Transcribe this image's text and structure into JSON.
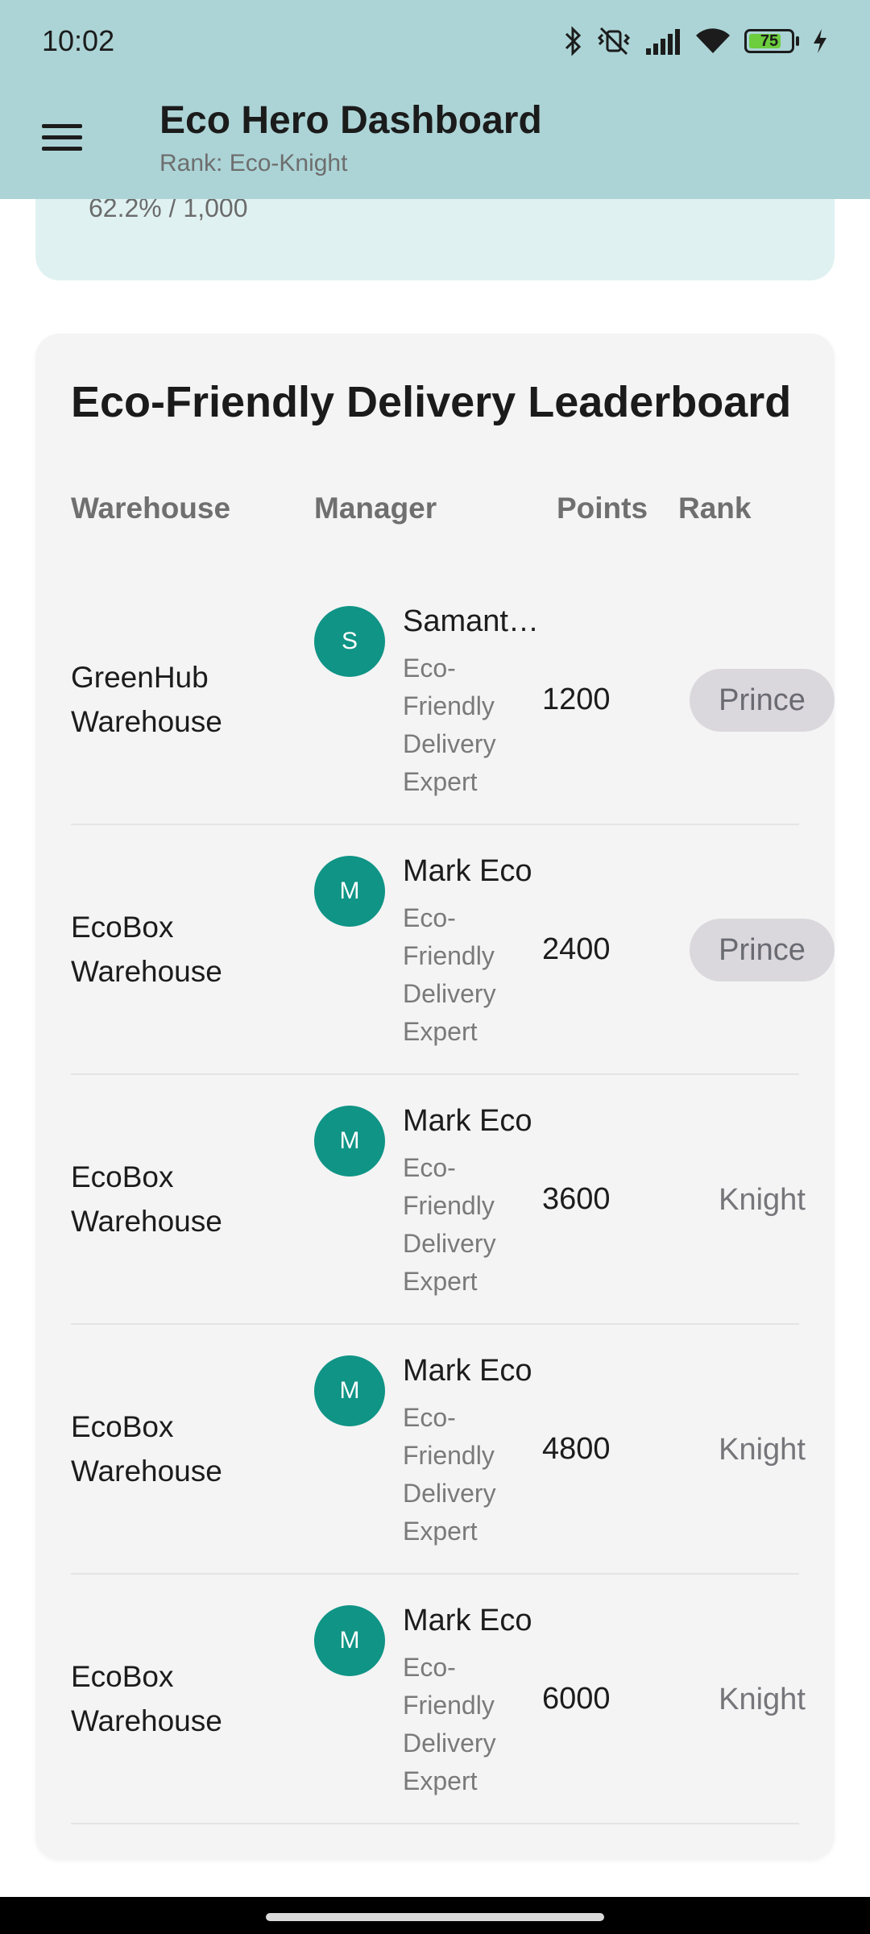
{
  "status_bar": {
    "time": "10:02",
    "battery_level": "75",
    "icons": [
      "bluetooth-icon",
      "vibrate-off-icon",
      "signal-icon",
      "wifi-icon",
      "battery-icon",
      "charging-icon"
    ]
  },
  "app_bar": {
    "title": "Eco Hero Dashboard",
    "subtitle": "Rank: Eco-Knight",
    "menu_icon": "hamburger-menu-icon"
  },
  "progress": {
    "text": "62.2% / 1,000"
  },
  "leaderboard": {
    "title": "Eco-Friendly Delivery Leaderboard",
    "columns": {
      "warehouse": "Warehouse",
      "manager": "Manager",
      "points": "Points",
      "rank": "Rank"
    },
    "rows": [
      {
        "warehouse": "GreenHub Warehouse",
        "initial": "S",
        "manager": "Samantha",
        "role": "Eco-Friendly Delivery Expert",
        "points": "1200",
        "rank": "Prince",
        "rank_style": "chip"
      },
      {
        "warehouse": "EcoBox Warehouse",
        "initial": "M",
        "manager": "Mark Eco",
        "role": "Eco-Friendly Delivery Expert",
        "points": "2400",
        "rank": "Prince",
        "rank_style": "chip"
      },
      {
        "warehouse": "EcoBox Warehouse",
        "initial": "M",
        "manager": "Mark Eco",
        "role": "Eco-Friendly Delivery Expert",
        "points": "3600",
        "rank": "Knight",
        "rank_style": "text"
      },
      {
        "warehouse": "EcoBox Warehouse",
        "initial": "M",
        "manager": "Mark Eco",
        "role": "Eco-Friendly Delivery Expert",
        "points": "4800",
        "rank": "Knight",
        "rank_style": "text"
      },
      {
        "warehouse": "EcoBox Warehouse",
        "initial": "M",
        "manager": "Mark Eco",
        "role": "Eco-Friendly Delivery Expert",
        "points": "6000",
        "rank": "Knight",
        "rank_style": "text"
      }
    ]
  },
  "colors": {
    "app_bar": "#acd4d6",
    "progress_card": "#e0f1f1",
    "avatar": "#0f9486",
    "rank_chip": "#dad8dd"
  }
}
